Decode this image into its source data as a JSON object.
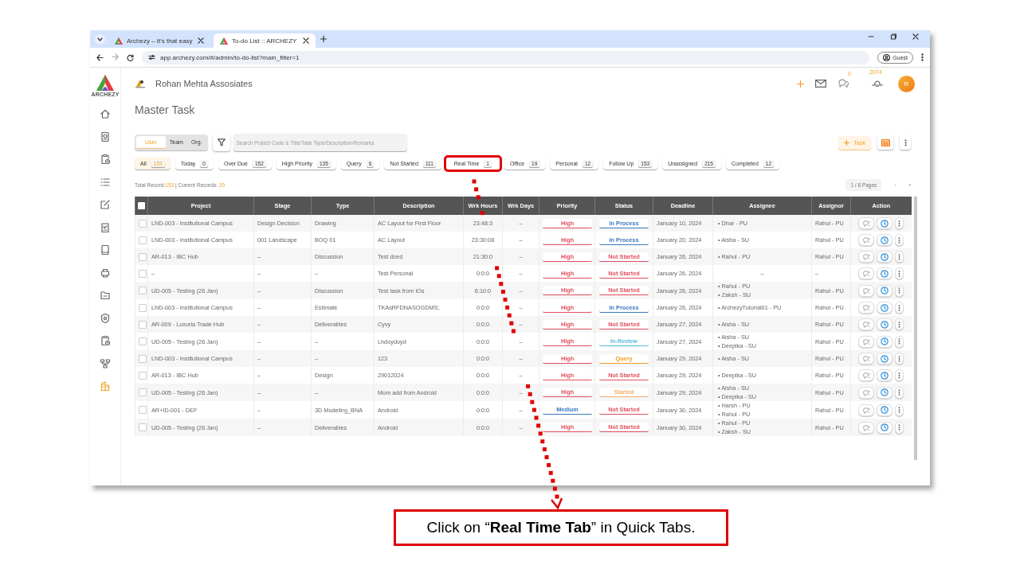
{
  "browser": {
    "tabs": [
      {
        "title": "Archezy – It's that easy",
        "selected": false
      },
      {
        "title": "To-do List :: ARCHEZY",
        "selected": true
      }
    ],
    "url": "app.archezy.com/#/admin/to-do-list?main_filter=1",
    "profile": "Guest"
  },
  "sidebar": {
    "logo_text": "ARCHEZY",
    "items": [
      {
        "selected": false
      },
      {
        "selected": false
      },
      {
        "selected": false
      },
      {
        "selected": false
      },
      {
        "selected": false
      },
      {
        "selected": false
      },
      {
        "selected": false
      },
      {
        "selected": false
      },
      {
        "selected": false
      },
      {
        "selected": false
      },
      {
        "selected": false
      },
      {
        "selected": false
      },
      {
        "selected": true
      }
    ]
  },
  "header": {
    "company": "Rohan Mehta Assosiates",
    "chat_count": "0",
    "notification_count": "2074",
    "avatar": "R"
  },
  "page_title": "Master Task",
  "scope_toggle": [
    {
      "label": "User",
      "selected": true
    },
    {
      "label": "Team",
      "selected": false
    },
    {
      "label": "Org.",
      "selected": false
    }
  ],
  "search": {
    "placeholder": "Search Project Code & Title/Task Type/Description/Remarks"
  },
  "add_task_button": "Task",
  "quick_tabs": [
    {
      "label": "All",
      "count": "153",
      "selected": true,
      "highlighted": false
    },
    {
      "label": "Today",
      "count": "0",
      "selected": false,
      "highlighted": false
    },
    {
      "label": "Over Due",
      "count": "152",
      "selected": false,
      "highlighted": false
    },
    {
      "label": "High Priority",
      "count": "135",
      "selected": false,
      "highlighted": false
    },
    {
      "label": "Query",
      "count": "6",
      "selected": false,
      "highlighted": false
    },
    {
      "label": "Not Started",
      "count": "111",
      "selected": false,
      "highlighted": false
    },
    {
      "label": "Real Time",
      "count": "1",
      "selected": false,
      "highlighted": true
    },
    {
      "label": "Office",
      "count": "19",
      "selected": false,
      "highlighted": false
    },
    {
      "label": "Personal",
      "count": "12",
      "selected": false,
      "highlighted": false
    },
    {
      "label": "Follow Up",
      "count": "153",
      "selected": false,
      "highlighted": false
    },
    {
      "label": "Unassigned",
      "count": "215",
      "selected": false,
      "highlighted": false
    },
    {
      "label": "Completed",
      "count": "12",
      "selected": false,
      "highlighted": false
    }
  ],
  "records": {
    "total_label": "Total Record:",
    "total": "153",
    "current_label": "| Current Records:",
    "current": "20"
  },
  "pagination": {
    "label": "1 / 8 Pages",
    "prev": "‹",
    "next": "›"
  },
  "table": {
    "select_all_checked": false,
    "columns": [
      "Project",
      "Stage",
      "Type",
      "Description",
      "Wrk Hours",
      "Wrk Days",
      "Priority",
      "Status",
      "Deadline",
      "Assignee",
      "Assignor",
      "Action"
    ],
    "rows": [
      {
        "checked": false,
        "cells": [
          "LND-003 - Institutional Campus",
          "Design Decision",
          "Drawing",
          "AC Layout for First Floor",
          "23:48:3",
          "–"
        ],
        "priority": {
          "label": "High",
          "color": "#e0505e"
        },
        "status": {
          "label": "In Process",
          "color": "#3a78c0"
        },
        "deadline": "January 10, 2024",
        "assignees": [
          "• Dhar - PU"
        ],
        "assignor": "Rahul - PU"
      },
      {
        "checked": false,
        "cells": [
          "LND-003 - Institutional Campus",
          "001 Landscape",
          "BOQ 01",
          "AC Layout",
          "23:30:08",
          "–"
        ],
        "priority": {
          "label": "High",
          "color": "#e0505e"
        },
        "status": {
          "label": "In Process",
          "color": "#3a78c0"
        },
        "deadline": "January 20, 2024",
        "assignees": [
          "• Aisha - SU"
        ],
        "assignor": "Rahul - PU"
      },
      {
        "checked": false,
        "cells": [
          "AR-013 - IBC Hub",
          "–",
          "Discussion",
          "Test dced",
          "21:30:0",
          "–"
        ],
        "priority": {
          "label": "High",
          "color": "#e0505e"
        },
        "status": {
          "label": "Not Started",
          "color": "#e0505e"
        },
        "deadline": "January 26, 2024",
        "assignees": [
          "• Rahul - PU"
        ],
        "assignor": "Rahul - PU"
      },
      {
        "checked": false,
        "cells": [
          "–",
          "–",
          "–",
          "Test Personal",
          "0:0:0",
          "–"
        ],
        "priority": {
          "label": "High",
          "color": "#e0505e"
        },
        "status": {
          "label": "Not Started",
          "color": "#e0505e"
        },
        "deadline": "January 26, 2024",
        "assignees": "–",
        "assignor": "–"
      },
      {
        "checked": false,
        "cells": [
          "UD-005 - Testing (26 Jan)",
          "–",
          "Discussion",
          "Test task from iOs",
          "6:10:0",
          "–"
        ],
        "priority": {
          "label": "High",
          "color": "#e0505e"
        },
        "status": {
          "label": "Not Started",
          "color": "#e0505e"
        },
        "deadline": "January 26, 2024",
        "assignees": [
          "• Rahul - PU",
          "• Zaksh - SU"
        ],
        "assignor": "Rahul - PU"
      },
      {
        "checked": false,
        "cells": [
          "LND-003 - Institutional Campus",
          "–",
          "Estimate",
          "TKAsRFDNASOGDMS;",
          "0:0:0",
          "–"
        ],
        "priority": {
          "label": "High",
          "color": "#e0505e"
        },
        "status": {
          "label": "In Process",
          "color": "#3a78c0"
        },
        "deadline": "January 26, 2024",
        "assignees": [
          "• ArchezyTutorial01 - PU"
        ],
        "assignor": "Rahul - PU"
      },
      {
        "checked": false,
        "cells": [
          "AR-009 - Luxuria Trade Hub",
          "–",
          "Deliverables",
          "Cyvy",
          "0:0:0",
          "–"
        ],
        "priority": {
          "label": "High",
          "color": "#e0505e"
        },
        "status": {
          "label": "Not Started",
          "color": "#e0505e"
        },
        "deadline": "January 27, 2024",
        "assignees": [
          "• Aisha - SU"
        ],
        "assignor": "Rahul - PU"
      },
      {
        "checked": false,
        "cells": [
          "UD-005 - Testing (26 Jan)",
          "–",
          "–",
          "Lhdoydoyd",
          "0:0:0",
          "–"
        ],
        "priority": {
          "label": "High",
          "color": "#e0505e"
        },
        "status": {
          "label": "In-Review",
          "color": "#5bbcd6"
        },
        "deadline": "January 27, 2024",
        "assignees": [
          "• Aisha - SU",
          "• Deepika - SU"
        ],
        "assignor": "Rahul - PU"
      },
      {
        "checked": false,
        "cells": [
          "LND-003 - Institutional Campus",
          "–",
          "–",
          "123",
          "0:0:0",
          "–"
        ],
        "priority": {
          "label": "High",
          "color": "#e0505e"
        },
        "status": {
          "label": "Query",
          "color": "#f0a020"
        },
        "deadline": "January 29, 2024",
        "assignees": [
          "• Aisha - SU"
        ],
        "assignor": "Rahul - PU"
      },
      {
        "checked": false,
        "cells": [
          "AR-013 - IBC Hub",
          "–",
          "Design",
          "29012024",
          "0:0:0",
          "–"
        ],
        "priority": {
          "label": "High",
          "color": "#e0505e"
        },
        "status": {
          "label": "Not Started",
          "color": "#e0505e"
        },
        "deadline": "January 29, 2024",
        "assignees": [
          "• Deepika - SU"
        ],
        "assignor": "Rahul - PU"
      },
      {
        "checked": false,
        "cells": [
          "UD-005 - Testing (26 Jan)",
          "–",
          "–",
          "Mom add from Android",
          "0:0:0",
          "–"
        ],
        "priority": {
          "label": "High",
          "color": "#e0505e"
        },
        "status": {
          "label": "Started",
          "color": "#f5b06a"
        },
        "deadline": "January 29, 2024",
        "assignees": [
          "• Aisha - SU",
          "• Deepika - SU"
        ],
        "assignor": "Rahul - PU"
      },
      {
        "checked": false,
        "cells": [
          "AR+ID-001 - DEF",
          "–",
          "3D Modeling_BNA",
          "Android",
          "0:0:0",
          "–"
        ],
        "priority": {
          "label": "Medium",
          "color": "#3a78c0"
        },
        "status": {
          "label": "Not Started",
          "color": "#e0505e"
        },
        "deadline": "January 30, 2024",
        "assignees": [
          "• Harsh - PU",
          "• Rahul - PU"
        ],
        "assignor": "Rahul - PU"
      },
      {
        "checked": false,
        "cells": [
          "UD-005 - Testing (26 Jan)",
          "–",
          "Deliverables",
          "Android",
          "0:0:0",
          "–"
        ],
        "priority": {
          "label": "High",
          "color": "#e0505e"
        },
        "status": {
          "label": "Not Started",
          "color": "#e0505e"
        },
        "deadline": "January 30, 2024",
        "assignees": [
          "• Rahul - PU",
          "• Zaksh - SU"
        ],
        "assignor": "Rahul - PU"
      }
    ]
  },
  "callout": "Click on “**Real Time Tab**” in Quick Tabs."
}
